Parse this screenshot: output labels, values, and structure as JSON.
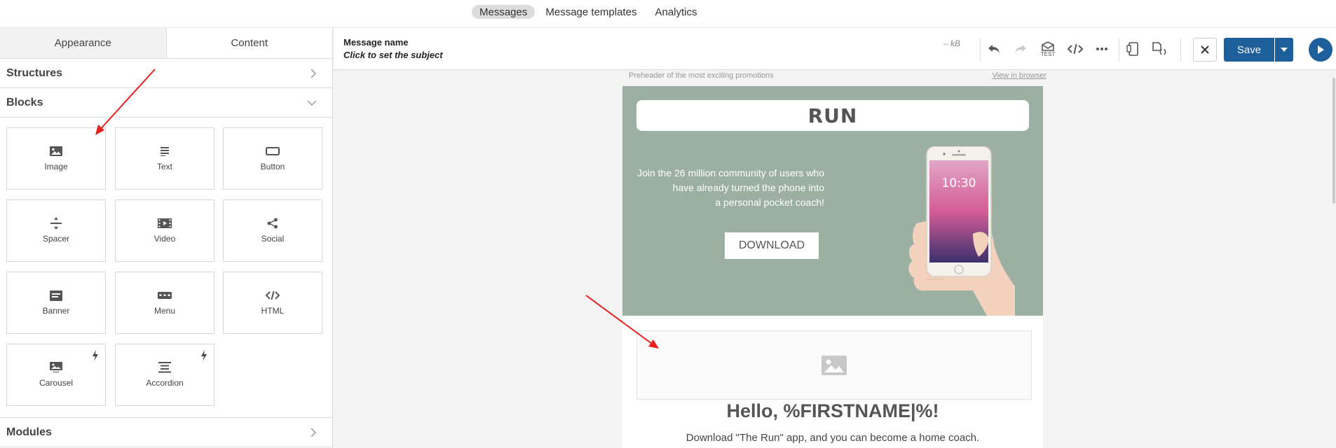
{
  "topnav": {
    "tabs": [
      {
        "label": "Messages",
        "active": true
      },
      {
        "label": "Message templates",
        "active": false
      },
      {
        "label": "Analytics",
        "active": false
      }
    ]
  },
  "panel": {
    "tabs": [
      {
        "label": "Appearance",
        "active": false
      },
      {
        "label": "Content",
        "active": true
      }
    ],
    "sections": {
      "structures": "Structures",
      "blocks": "Blocks",
      "modules": "Modules"
    },
    "blocks": [
      {
        "label": "Image",
        "icon": "image-icon"
      },
      {
        "label": "Text",
        "icon": "text-icon"
      },
      {
        "label": "Button",
        "icon": "button-icon"
      },
      {
        "label": "Spacer",
        "icon": "spacer-icon"
      },
      {
        "label": "Video",
        "icon": "video-icon"
      },
      {
        "label": "Social",
        "icon": "share-icon"
      },
      {
        "label": "Banner",
        "icon": "banner-icon"
      },
      {
        "label": "Menu",
        "icon": "menu-icon"
      },
      {
        "label": "HTML",
        "icon": "code-icon"
      },
      {
        "label": "Carousel",
        "icon": "carousel-icon",
        "amp": true
      },
      {
        "label": "Accordion",
        "icon": "accordion-icon",
        "amp": true
      }
    ]
  },
  "header": {
    "message_name": "Message name",
    "subject": "Click to set the subject",
    "size": "– kB",
    "save_label": "Save",
    "test_label": "TEST"
  },
  "email": {
    "preheader": "Preheader of the most exciting promotions",
    "view_in_browser": "View in browser",
    "logo": "RUN",
    "hero_lines": [
      "Join the 26 million community of users who",
      "have already turned the phone into",
      "a personal pocket coach!"
    ],
    "download_label": "DOWNLOAD",
    "phone_time": "10:30",
    "greeting": "Hello, %FIRSTNAME|%!",
    "description": "Download \"The Run\" app, and you can become a home coach."
  },
  "colors": {
    "accent": "#1c5f9a",
    "hero_bg": "#9bafa3",
    "annotation_arrow": "#e3201b"
  }
}
